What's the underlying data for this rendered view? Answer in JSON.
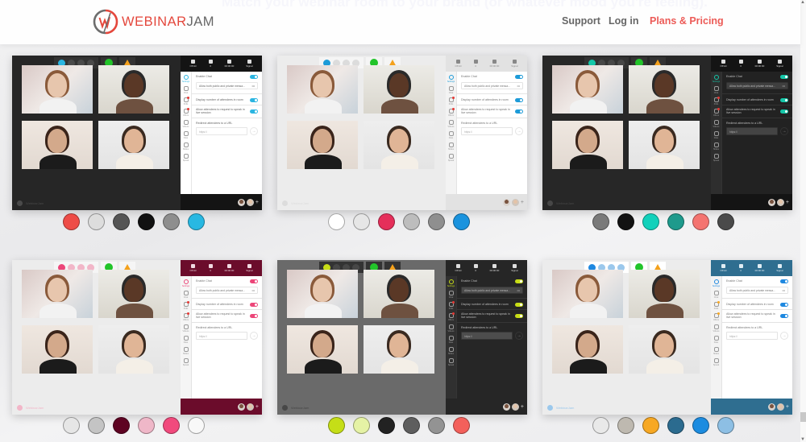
{
  "header": {
    "headline": "Match your webinar room to your brand (or whatever mood you're feeling).",
    "logo": {
      "part1": "WEBINAR",
      "part2": "JAM"
    },
    "nav": [
      {
        "label": "Support"
      },
      {
        "label": "Log in"
      },
      {
        "label": "Plans & Pricing"
      }
    ]
  },
  "room": {
    "stats": [
      "Off Air",
      "0",
      "00:00:00",
      "Signal"
    ],
    "nav_items": [
      "Settings",
      "Chat",
      "Polls",
      "Offers",
      "Videos",
      "Files",
      "Slides",
      "Speak"
    ],
    "settings": {
      "enable_chat": "Enable Chat",
      "chat_mode": "Allow both public and private messa...",
      "dropdown_icon": "•••",
      "display_count": "Display number of attendees in room",
      "allow_speak": "Allow attendees to request to speak in live session",
      "redirect": "Redirect attendees to a URL",
      "url_placeholder": "https://"
    },
    "footer_brand": "WebinarJam"
  },
  "themes": [
    {
      "name": "dark-cyan",
      "stage": "#262626",
      "side": "#ffffff",
      "side_top": "#141414",
      "side_nav": "#ffffff",
      "side_bottom": "#141414",
      "accent": "#2bb5e1",
      "text": "#666666",
      "top_text": "#dddddd",
      "control": "#3a3a3a",
      "select": "#ffffff",
      "url": "#ffffff",
      "border": "#e6e6e6",
      "tb_bg": "#333333",
      "tb_btn": "#4a4a4a",
      "swatches": [
        "#ee4c47",
        "#dddddd",
        "#555555",
        "#111111",
        "#8e8e8e",
        "#28b8e2"
      ]
    },
    {
      "name": "light-blue",
      "stage": "#ececec",
      "side": "#ffffff",
      "side_top": "#e2e2e2",
      "side_nav": "#f3f3f3",
      "side_bottom": "#e2e2e2",
      "accent": "#1d9bd8",
      "text": "#777777",
      "top_text": "#888888",
      "control": "#ffffff",
      "select": "#ffffff",
      "url": "#ffffff",
      "border": "#e3e3e3",
      "tb_bg": "#f5f5f5",
      "tb_btn": "#dcdcdc",
      "swatches": [
        "#ffffff",
        "#e6e6e6",
        "#e52f5a",
        "#bdbdbd",
        "#8f8f8f",
        "#1a93de"
      ]
    },
    {
      "name": "dark-teal",
      "stage": "#272727",
      "side": "#222222",
      "side_top": "#141414",
      "side_nav": "#2e2e2e",
      "side_bottom": "#141414",
      "accent": "#14c7a8",
      "text": "#bbbbbb",
      "top_text": "#dddddd",
      "control": "#3d3d3d",
      "select": "#3f3f3f",
      "url": "#444444",
      "border": "#333333",
      "tb_bg": "#333333",
      "tb_btn": "#474747",
      "swatches": [
        "#7a7a7a",
        "#121212",
        "#12d1bb",
        "#1e9a8c",
        "#f47470",
        "#4a4a4a"
      ]
    },
    {
      "name": "light-crimson",
      "stage": "#ececec",
      "side": "#ffffff",
      "side_top": "#6b0c2b",
      "side_nav": "#f5f5f5",
      "side_bottom": "#6b0c2b",
      "accent": "#ec4679",
      "text": "#777777",
      "top_text": "#f0d9e1",
      "control": "#ffffff",
      "select": "#ffffff",
      "url": "#ffffff",
      "border": "#e3e3e3",
      "tb_bg": "#f5f5f5",
      "tb_btn": "#f2b6c8",
      "swatches": [
        "#e6e6e6",
        "#c4c4c4",
        "#5e0322",
        "#efb7c8",
        "#f14a7d",
        "#f8f8f8"
      ]
    },
    {
      "name": "gray-lime",
      "stage": "#6a6a6a",
      "side": "#262626",
      "side_top": "#262626",
      "side_nav": "#303030",
      "side_bottom": "#262626",
      "accent": "#c7dd16",
      "text": "#bbbbbb",
      "top_text": "#dddddd",
      "control": "#3d3d3d",
      "select": "#4a4a4a",
      "url": "#4d4d4d",
      "border": "#363636",
      "tb_bg": "#333333",
      "tb_btn": "#474747",
      "swatches": [
        "#c5de17",
        "#e5f2a5",
        "#222222",
        "#5e5e5e",
        "#939393",
        "#f3605b"
      ]
    },
    {
      "name": "light-steel-blue",
      "stage": "#ececec",
      "side": "#ffffff",
      "side_top": "#2f6e90",
      "side_nav": "#f3f3f3",
      "side_bottom": "#2f6e90",
      "accent": "#1e88e0",
      "text": "#777777",
      "top_text": "#e0ecf3",
      "control": "#ffffff",
      "select": "#ffffff",
      "url": "#ffffff",
      "border": "#e3e3e3",
      "tb_bg": "#ffffff",
      "tb_btn": "#9bc8ec",
      "swatches": [
        "#e9e9e9",
        "#beb9b0",
        "#f7a823",
        "#2b6b8f",
        "#1c8ce0",
        "#8dbfe4"
      ]
    }
  ]
}
